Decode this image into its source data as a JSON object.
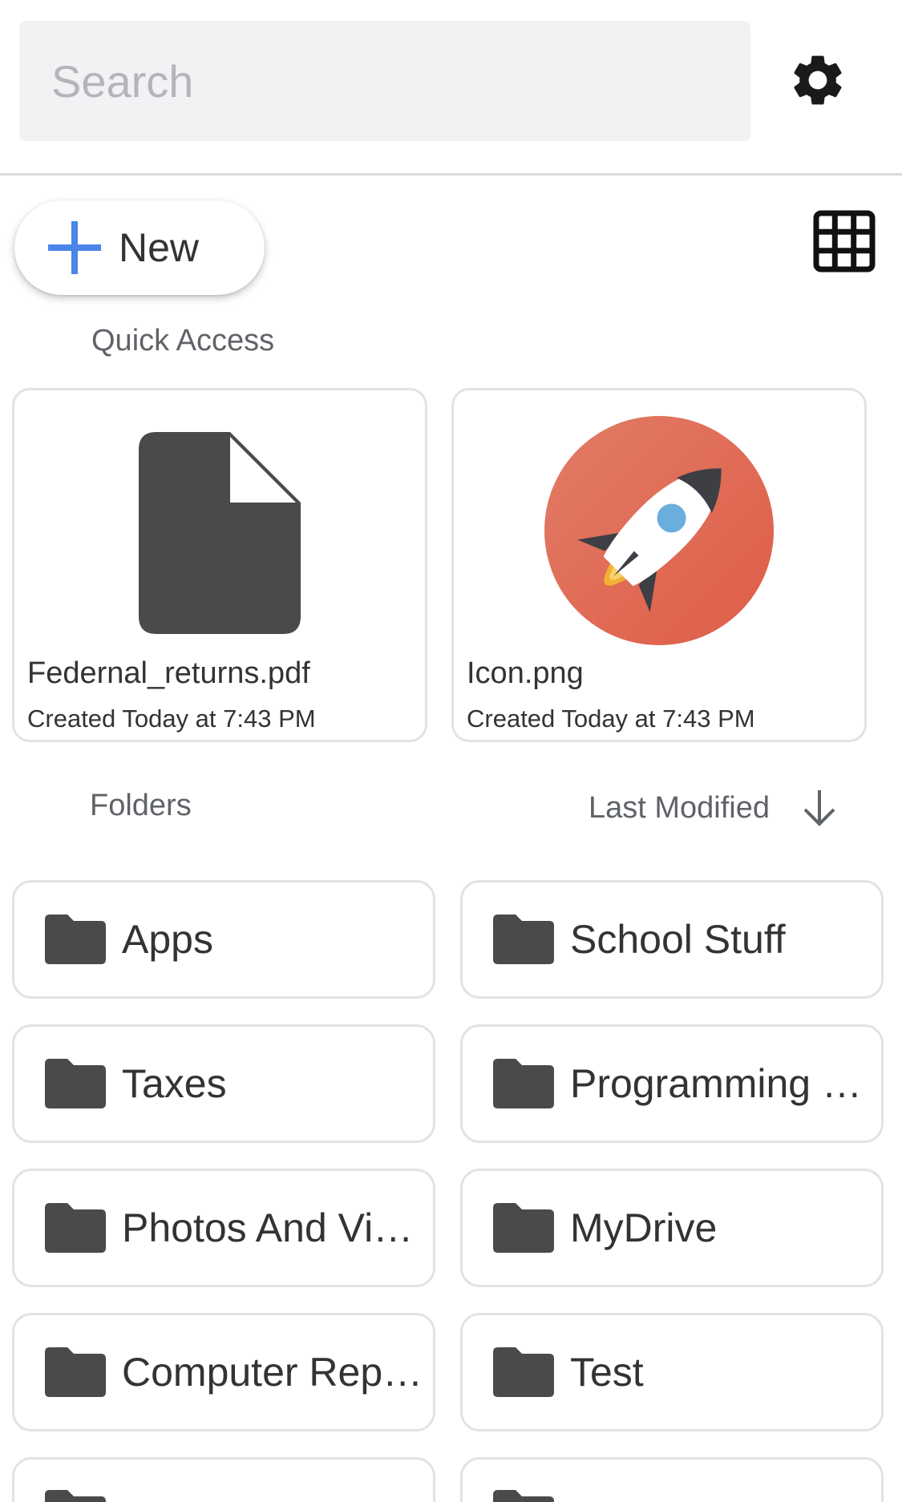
{
  "header": {
    "search_placeholder": "Search",
    "settings_icon": "gear-icon"
  },
  "toolbar": {
    "new_label": "New",
    "new_icon": "plus-icon",
    "view_toggle_icon": "grid-view-icon"
  },
  "quick_access": {
    "title": "Quick Access",
    "items": [
      {
        "name": "Federnal_returns.pdf",
        "meta": "Created Today at 7:43 PM",
        "icon": "document-icon"
      },
      {
        "name": "Icon.png",
        "meta": "Created Today at 7:43 PM",
        "icon": "rocket-icon"
      }
    ]
  },
  "folders": {
    "title": "Folders",
    "sort_label": "Last Modified",
    "sort_icon": "arrow-down-icon",
    "items": [
      {
        "name": "Apps"
      },
      {
        "name": "School Stuff"
      },
      {
        "name": "Taxes"
      },
      {
        "name": "Programming Stuff"
      },
      {
        "name": "Photos And Videos"
      },
      {
        "name": "MyDrive"
      },
      {
        "name": "Computer Repair"
      },
      {
        "name": "Test"
      },
      {
        "name": ""
      },
      {
        "name": ""
      }
    ]
  },
  "colors": {
    "accent_blue": "#4a86e8",
    "icon_dark": "#4a4a4a",
    "rocket_bg": "#e0664f"
  }
}
